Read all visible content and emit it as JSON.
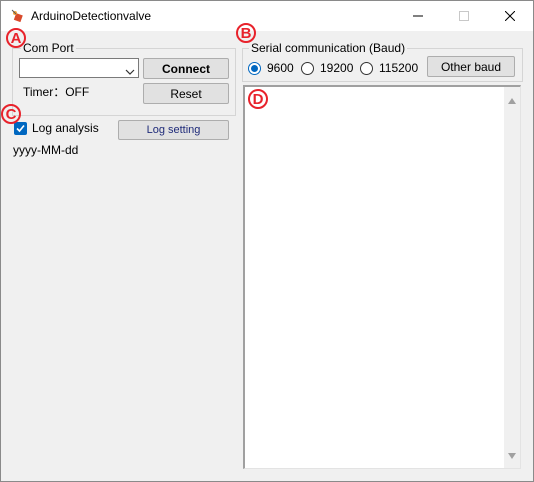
{
  "window": {
    "title": "ArduinoDetectionvalve"
  },
  "com_port_group": {
    "label": "Com Port",
    "port_value": "",
    "connect_label": "Connect",
    "timer_label": "Timer：OFF",
    "reset_label": "Reset"
  },
  "log_group": {
    "checkbox_label": "Log analysis",
    "checked": true,
    "setting_button_label": "Log setting",
    "date_format": "yyyy-MM-dd"
  },
  "serial_group": {
    "label": "Serial communication (Baud)",
    "options": [
      {
        "label": "9600",
        "selected": true
      },
      {
        "label": "19200",
        "selected": false
      },
      {
        "label": "115200",
        "selected": false
      }
    ],
    "other_baud_label": "Other baud"
  },
  "output": {
    "text": ""
  },
  "markers": {
    "a": "A",
    "b": "B",
    "c": "C",
    "d": "D"
  },
  "colors": {
    "accent": "#0067c0",
    "marker": "#e8222b"
  }
}
